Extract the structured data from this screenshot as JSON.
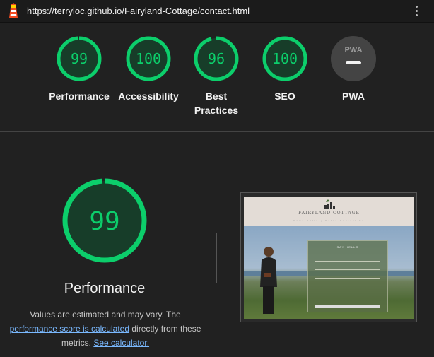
{
  "topbar": {
    "url": "https://terryloc.github.io/Fairyland-Cottage/contact.html",
    "logo_icon": "lighthouse-icon",
    "menu_icon": "more-vert-icon"
  },
  "colors": {
    "pass": "#0cce6b",
    "pass_bg": "#173d29",
    "pwa_bg": "#444444",
    "link": "#7ab9ff"
  },
  "scores": [
    {
      "label": "Performance",
      "value": "99",
      "fraction": 0.99
    },
    {
      "label": "Accessibility",
      "value": "100",
      "fraction": 1.0
    },
    {
      "label": "Best Practices",
      "value": "96",
      "fraction": 0.96
    },
    {
      "label": "SEO",
      "value": "100",
      "fraction": 1.0
    },
    {
      "label": "PWA",
      "value": "",
      "badge_text": "PWA"
    }
  ],
  "detail": {
    "score": "99",
    "fraction": 0.99,
    "title": "Performance",
    "desc_part1": "Values are estimated and may vary. The",
    "link1": "performance score is calculated",
    "desc_part2": "directly from these",
    "desc_part3": "metrics.",
    "link2": "See calculator."
  },
  "thumbnail": {
    "brand": "FAIRYLAND COTTAGE",
    "nav": "Home Gallery Rates Contact Us",
    "form_title": "SAY HELLO"
  }
}
